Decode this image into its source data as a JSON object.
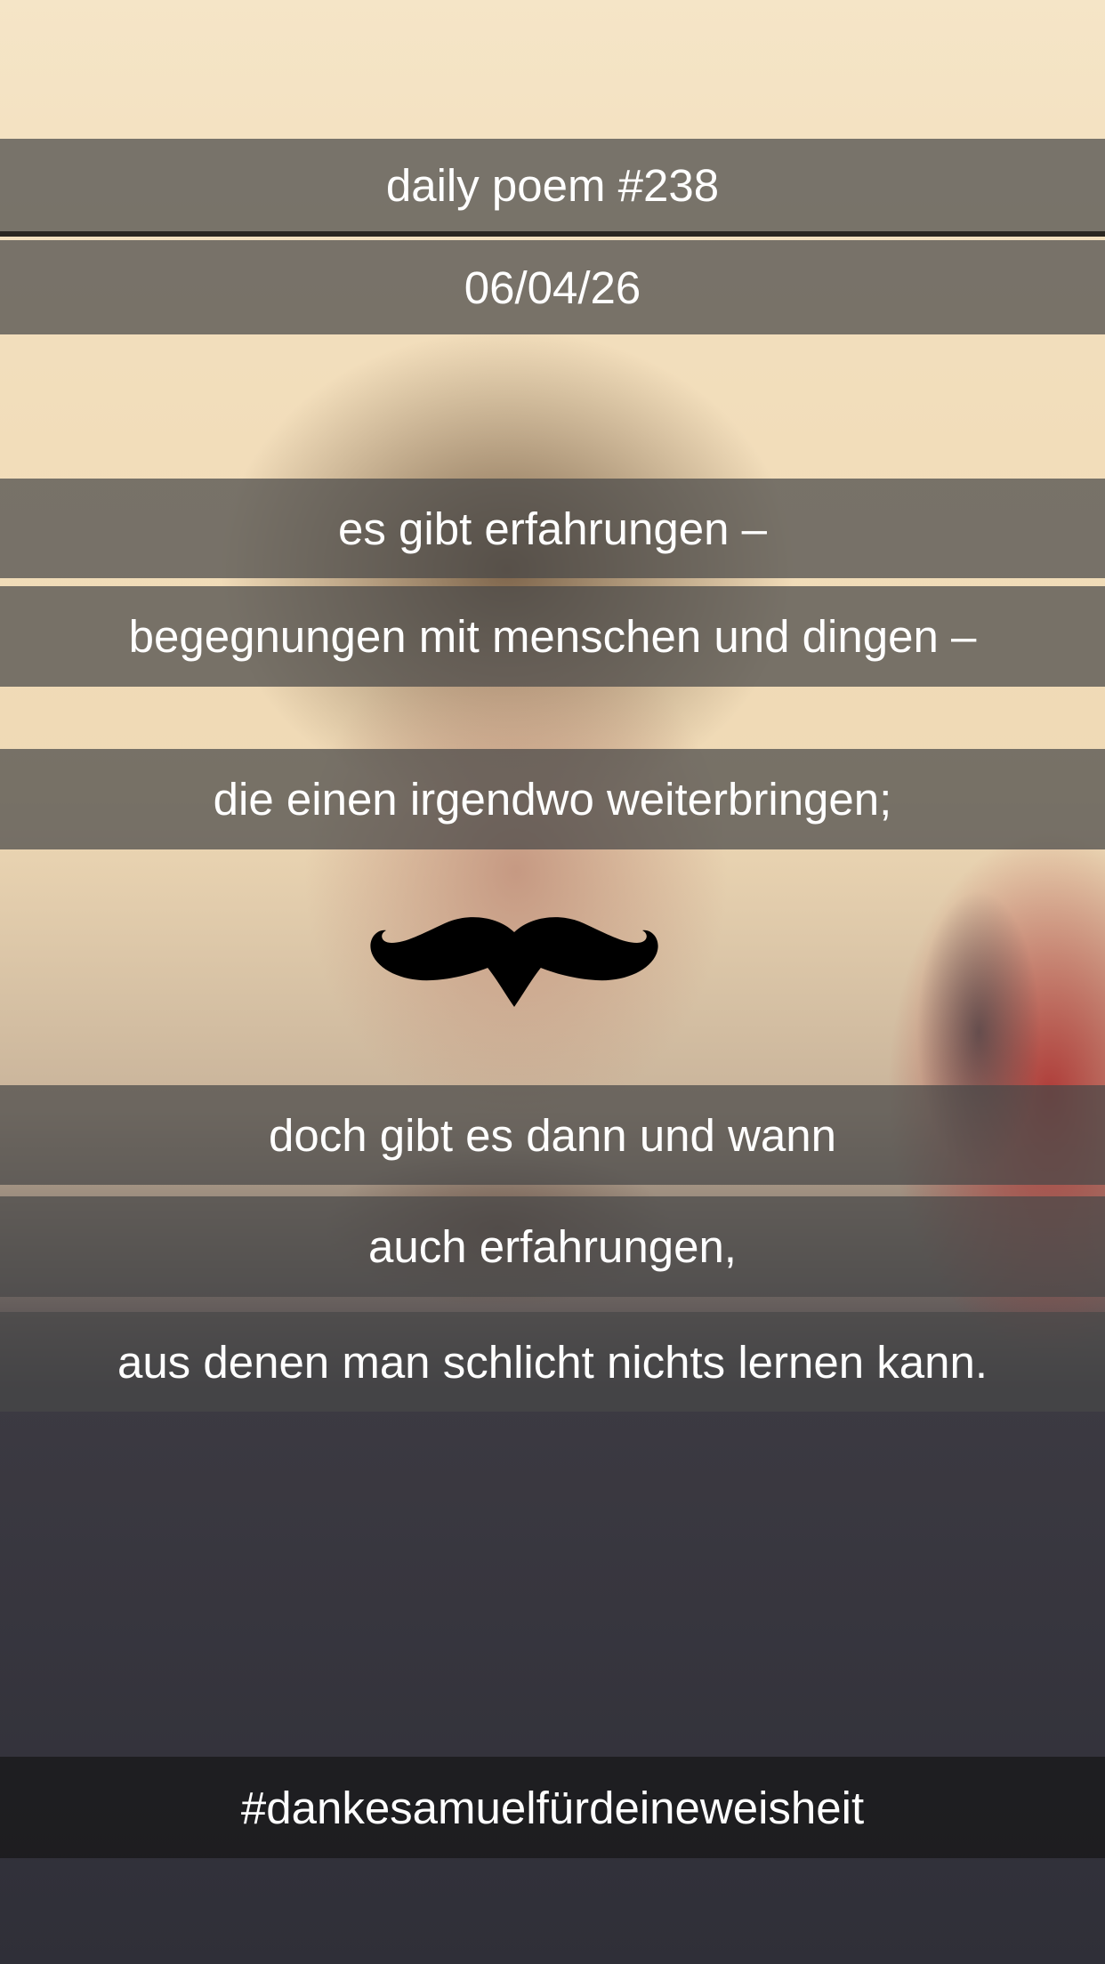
{
  "header": {
    "title": "daily poem #238",
    "date": "06/04/26"
  },
  "poem": {
    "lines": [
      "es gibt erfahrungen –",
      "begegnungen mit menschen und dingen –",
      "die einen irgendwo weiterbringen;",
      "doch gibt es dann und wann",
      "auch erfahrungen,",
      "aus denen man schlicht nichts lernen kann."
    ]
  },
  "footer": {
    "hashtag": "#dankesamuelfürdeineweisheit"
  },
  "sticker": {
    "icon": "mustache-icon",
    "color": "#000000"
  }
}
